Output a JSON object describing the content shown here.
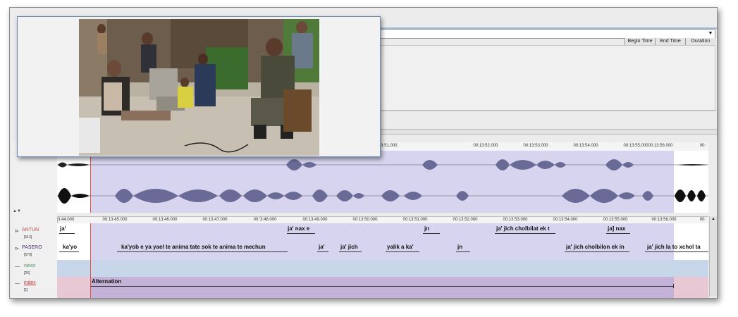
{
  "table": {
    "columns": [
      "Begin Time",
      "End Time",
      "Duration"
    ]
  },
  "timeline": {
    "top_ticks": [
      "00:13:51.000",
      "00:13:52.000",
      "00:13:53.000",
      "00:13:54.000",
      "00:13:55.000",
      "00:13:56.000",
      "00:"
    ],
    "tier_ticks": [
      "r13:44.000",
      "00:13:45.000",
      "00:13:46.000",
      "00:13:47.000",
      "00:'3:48.000",
      "00:13:49.000",
      "00:13:50.000",
      "00:13:51.000",
      "00:13:52.000",
      "00:13:53.000",
      "00:13:54.000",
      "00:13:55.000",
      "00:13:56.000",
      "00:"
    ]
  },
  "tiers": [
    {
      "name": "ANTUN",
      "count": "[513]",
      "color": "#b05050",
      "annotations": [
        "ja'",
        "ja' nax e",
        "jn",
        "ja' jich cholbilat ek t",
        "ja] nax"
      ]
    },
    {
      "name": "PASERO",
      "count": "[579]",
      "color": "#503070",
      "annotations": [
        "ka'yo",
        "ka'yob e ya yael te   anima tate sok te anima  te mechun",
        "ja'",
        "ja' jich",
        "yalik a ka'",
        "jn",
        "ja' jich cholbilon ek in",
        "ja' jich la to xchol ta"
      ]
    },
    {
      "name": "news",
      "count": "[26]",
      "color": "#4a9a5a",
      "annotations": []
    },
    {
      "name": "index",
      "count": "[1]",
      "color": "#d03030",
      "annotations": [
        "Alternation"
      ]
    }
  ],
  "colors": {
    "selection": "#a5a0dc",
    "cursor": "#e74c3c",
    "news_row": "#c8d6ea",
    "index_row": "#e8c8d4",
    "video_border": "#6a8bb3"
  },
  "icons": [
    "dropdown-arrow-icon",
    "tier-expand-icon",
    "scroll-up-icon"
  ]
}
